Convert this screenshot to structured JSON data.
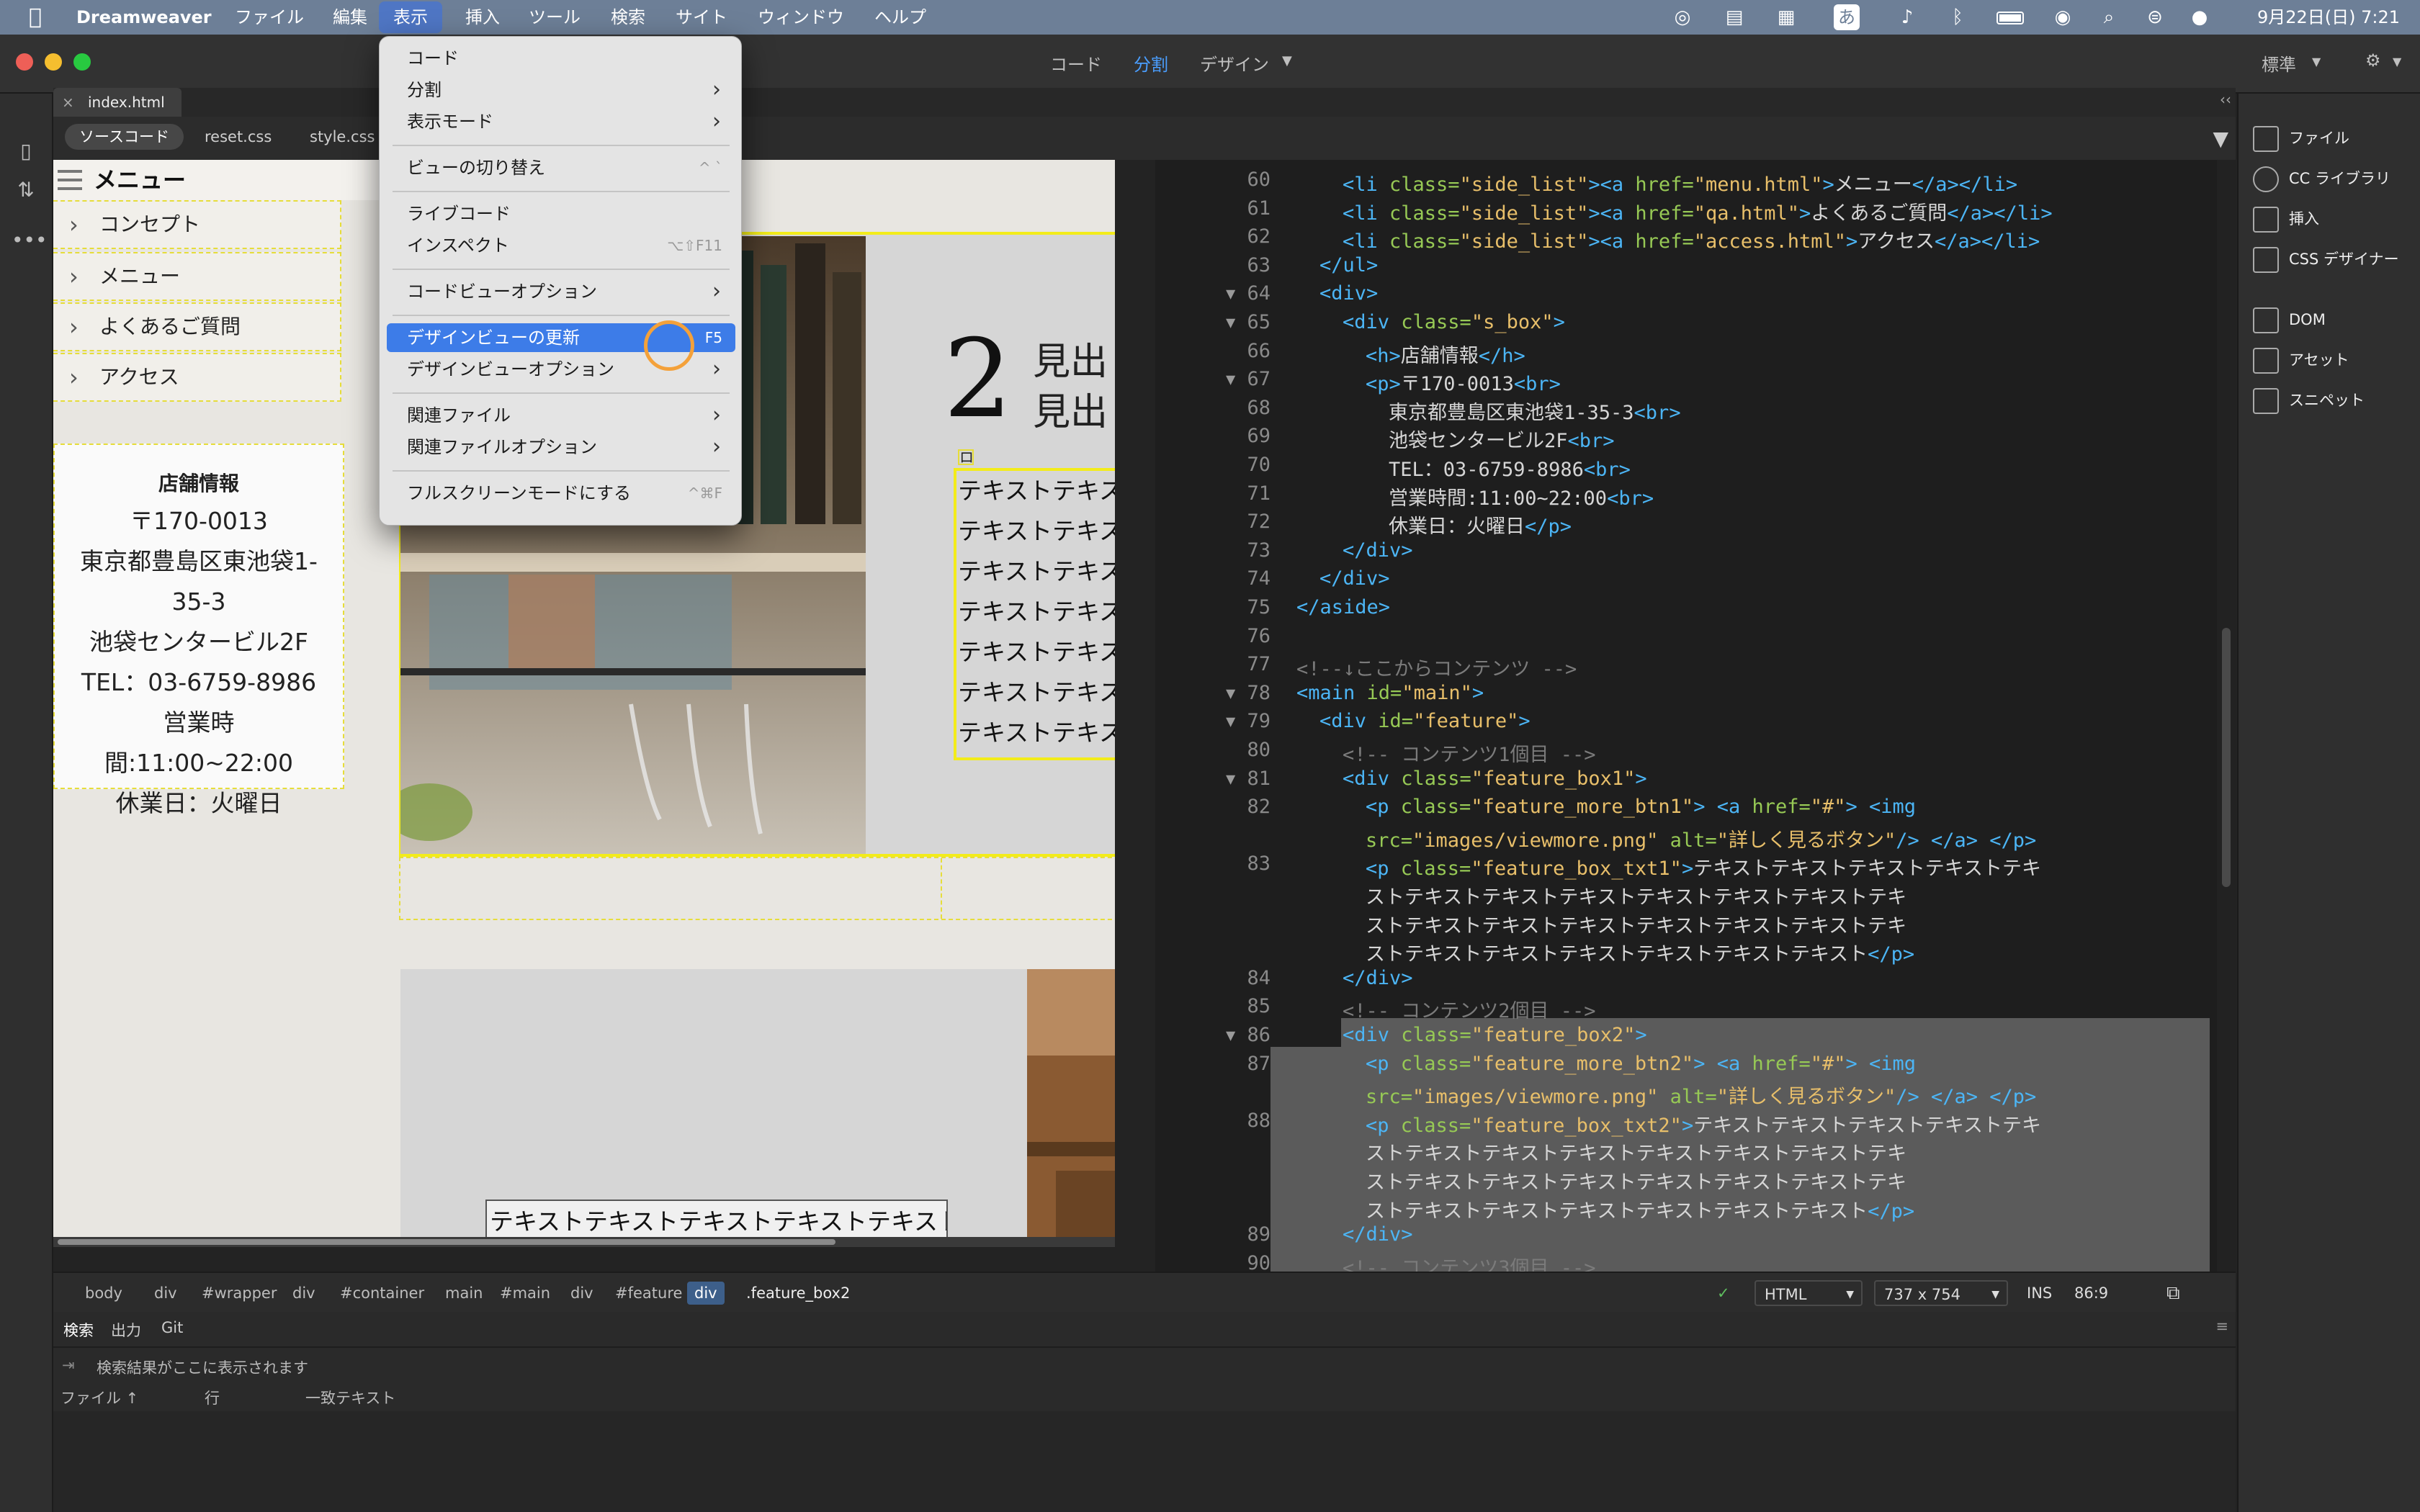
{
  "menubar": {
    "items": [
      "Dreamweaver",
      "ファイル",
      "編集",
      "表示",
      "挿入",
      "ツール",
      "検索",
      "サイト",
      "ウィンドウ",
      "ヘルプ"
    ],
    "status_input_method": "あ",
    "clock": "9月22日(日)  7:21"
  },
  "toolbar": {
    "view_code": "コード",
    "view_split": "分割",
    "view_design": "デザイン",
    "workspace": "標準"
  },
  "document": {
    "file_tab": "index.html",
    "related_files": [
      "ソースコード",
      "reset.css",
      "style.css"
    ]
  },
  "design_view": {
    "menu_heading": "メニュー",
    "nav_items": [
      "コンセプト",
      "メニュー",
      "よくあるご質問",
      "アクセス"
    ],
    "shop": {
      "heading": "店舗情報",
      "lines": [
        "〒170-0013",
        "東京都豊島区東池袋1-",
        "35-3",
        "池袋センタービル2F",
        "TEL：03-6759-8986",
        "営業時間:11:00~22:00",
        "休業日：火曜日"
      ]
    },
    "feature_number": "2",
    "feature_heading_lines": [
      "見出",
      "見出"
    ],
    "feature_text_lines": [
      "テキストテキス",
      "テキストテキス",
      "テキストテキス",
      "テキストテキス",
      "テキストテキス",
      "テキストテキス",
      "テキストテキス"
    ],
    "small_marker": "ロ",
    "feature2_text": "テキストテキストテキストテキストテキスト"
  },
  "code_view": {
    "line_numbers": [
      "60",
      "61",
      "62",
      "63",
      "64",
      "65",
      "66",
      "67",
      "68",
      "69",
      "70",
      "71",
      "72",
      "73",
      "74",
      "75",
      "76",
      "77",
      "78",
      "79",
      "80",
      "81",
      "82",
      "",
      "83",
      "",
      "",
      "",
      "84",
      "85",
      "86",
      "87",
      "",
      "88",
      "",
      "",
      "",
      "89",
      "90"
    ]
  },
  "dropdown": {
    "items": [
      {
        "label": "コード",
        "shortcut": ""
      },
      {
        "label": "分割",
        "shortcut": "›"
      },
      {
        "label": "表示モード",
        "shortcut": "›"
      },
      {
        "label": "ビューの切り替え",
        "shortcut": "^ `"
      },
      {
        "label": "ライブコード",
        "shortcut": ""
      },
      {
        "label": "インスペクト",
        "shortcut": "⌥⇧F11"
      },
      {
        "label": "コードビューオプション",
        "shortcut": "›"
      },
      {
        "label": "デザインビューの更新",
        "shortcut": "F5"
      },
      {
        "label": "デザインビューオプション",
        "shortcut": "›"
      },
      {
        "label": "関連ファイル",
        "shortcut": "›"
      },
      {
        "label": "関連ファイルオプション",
        "shortcut": "›"
      },
      {
        "label": "フルスクリーンモードにする",
        "shortcut": "^⌘F"
      }
    ]
  },
  "right_panel": {
    "items": [
      "ファイル",
      "CC ライブラリ",
      "挿入",
      "CSS デザイナー",
      "DOM",
      "アセット",
      "スニペット"
    ]
  },
  "statusbar": {
    "breadcrumbs": [
      "body",
      "div",
      "#wrapper",
      "div",
      "#container",
      "main",
      "#main",
      "div",
      "#feature",
      "div",
      ".feature_box2"
    ],
    "doc_type": "HTML",
    "viewport": "737 x 754",
    "mode": "INS",
    "cursor_pos": "86:9"
  },
  "bottom_panel": {
    "tabs": [
      "検索",
      "出力",
      "Git"
    ],
    "placeholder": "検索結果がここに表示されます",
    "columns": [
      "ファイル ↑",
      "行",
      "一致テキスト"
    ]
  },
  "colors": {
    "menubar": "#6d7f97",
    "accent_blue": "#3d7ce8",
    "yellow_outline": "#f3ec1a",
    "cursor_ring": "#f4a13a"
  }
}
